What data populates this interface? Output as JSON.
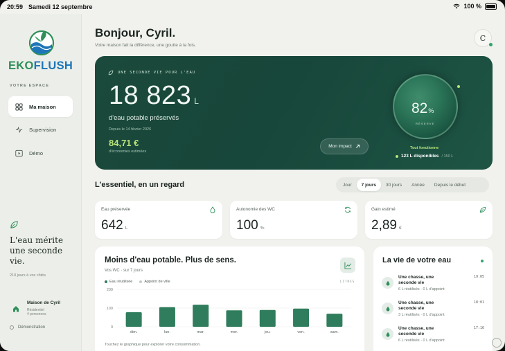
{
  "status_bar": {
    "time": "20:59",
    "date": "Samedi 12 septembre",
    "battery": "100 %"
  },
  "sidebar": {
    "brand_part1": "EKO",
    "brand_part2": "FLUSH",
    "section_label": "VOTRE ESPACE",
    "nav": [
      {
        "label": "Ma maison",
        "icon": "grid-icon",
        "active": true
      },
      {
        "label": "Supervision",
        "icon": "pulse-icon",
        "active": false
      },
      {
        "label": "Démo",
        "icon": "play-icon",
        "active": false
      }
    ],
    "quote": "L'eau mérite une seconde vie.",
    "days": "210 jours à vos côtés",
    "home": {
      "name": "Maison de Cyril",
      "type": "Résidentiel",
      "people": "4 personnes"
    },
    "demo": "Démonstration"
  },
  "header": {
    "greeting": "Bonjour, Cyril.",
    "subtitle": "Votre maison fait la différence, une goutte à la fois.",
    "avatar_initial": "C"
  },
  "hero": {
    "kicker": "UNE SECONDE VIE POUR L'EAU",
    "liters_value": "18 823",
    "liters_unit": "L",
    "liters_desc": "d'eau potable préservés",
    "since": "Depuis le 14 février 2026",
    "money": "84,71 €",
    "money_desc": "d'économies estimées",
    "impact_button": "Mon impact",
    "reserve_pct": 82,
    "reserve_pct_text": "82",
    "reserve_pct_unit": "%",
    "reserve_label": "RÉSERVE",
    "status_ok": "Tout fonctionne",
    "available": "123 L disponibles",
    "capacity": "/ 150 L"
  },
  "essentials": {
    "title": "L'essentiel, en un regard",
    "periods": [
      {
        "label": "Jour",
        "active": false
      },
      {
        "label": "7 jours",
        "active": true
      },
      {
        "label": "30 jours",
        "active": false
      },
      {
        "label": "Année",
        "active": false
      },
      {
        "label": "Depuis le début",
        "active": false
      }
    ],
    "kpis": [
      {
        "label": "Eau préservée",
        "value": "642",
        "unit": "L",
        "icon": "drop-icon"
      },
      {
        "label": "Autonomie des WC",
        "value": "100",
        "unit": "%",
        "icon": "refresh-icon"
      },
      {
        "label": "Gain estimé",
        "value": "2,89",
        "unit": "€",
        "icon": "leaf-icon"
      }
    ]
  },
  "chart_card": {
    "title": "Moins d'eau potable. Plus de sens.",
    "subtitle": "Vos WC · sur 7 jours",
    "units_label": "LITRES",
    "hint": "Touchez le graphique pour explorer votre consommation."
  },
  "chart_data": {
    "type": "bar",
    "categories": [
      "dim.",
      "lun.",
      "mar.",
      "mer.",
      "jeu.",
      "ven.",
      "sam."
    ],
    "series": [
      {
        "name": "Eau réutilisée",
        "values": [
          78,
          105,
          118,
          88,
          90,
          97,
          70
        ],
        "color": "#2f7d5c"
      },
      {
        "name": "Appoint de ville",
        "values": [
          0,
          0,
          0,
          0,
          0,
          0,
          0
        ],
        "color": "#c6cdc8"
      }
    ],
    "yticks": [
      0,
      100,
      200
    ],
    "ylim": [
      0,
      200
    ],
    "legend": "top-left",
    "grid": true
  },
  "feed": {
    "title": "La vie de votre eau",
    "items": [
      {
        "title": "Une chasse, une seconde vie",
        "detail": "6 L réutilisés · 0 L d'appoint",
        "time": "19:05"
      },
      {
        "title": "Une chasse, une seconde vie",
        "detail": "3 L réutilisés · 0 L d'appoint",
        "time": "18:01"
      },
      {
        "title": "Une chasse, une seconde vie",
        "detail": "6 L réutilisés · 0 L d'appoint",
        "time": "17:16"
      }
    ]
  },
  "colors": {
    "brand_green": "#2e8f5a",
    "brand_blue": "#1e76b8",
    "hero_bg": "#1b4a3c",
    "accent_lime": "#b9e37a"
  }
}
